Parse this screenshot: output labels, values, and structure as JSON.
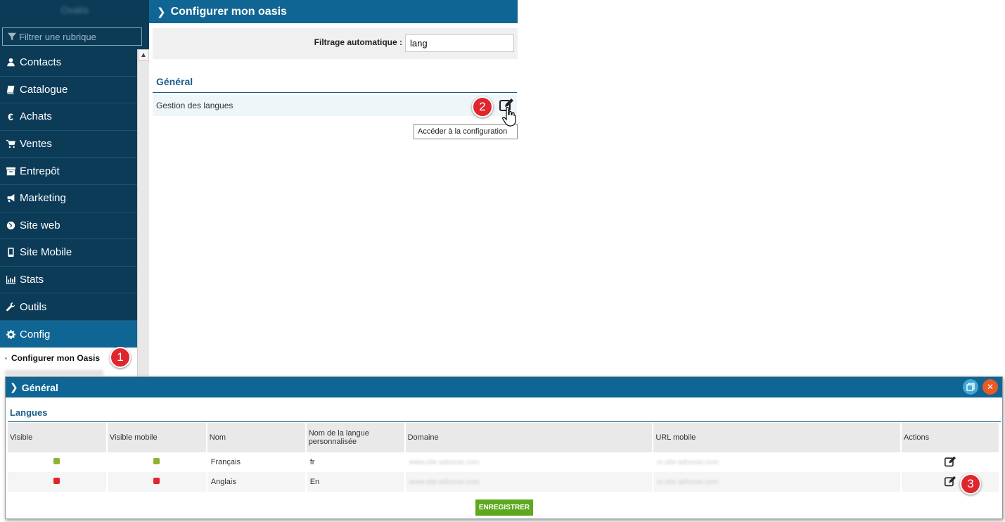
{
  "sidebar": {
    "brand": "Oxatis",
    "filter_placeholder": "Filtrer une rubrique",
    "items": [
      {
        "label": "Contacts",
        "icon": "user-icon"
      },
      {
        "label": "Catalogue",
        "icon": "book-icon"
      },
      {
        "label": "Achats",
        "icon": "euro-icon"
      },
      {
        "label": "Ventes",
        "icon": "cart-icon"
      },
      {
        "label": "Entrepôt",
        "icon": "archive-icon"
      },
      {
        "label": "Marketing",
        "icon": "megaphone-icon"
      },
      {
        "label": "Site web",
        "icon": "globe-icon"
      },
      {
        "label": "Site Mobile",
        "icon": "mobile-icon"
      },
      {
        "label": "Stats",
        "icon": "bar-chart-icon"
      },
      {
        "label": "Outils",
        "icon": "wrench-icon"
      },
      {
        "label": "Config",
        "icon": "gear-icon"
      }
    ],
    "current_sub": "Configurer mon Oasis"
  },
  "badges": {
    "one": "1",
    "two": "2",
    "three": "3"
  },
  "main": {
    "title": "Configurer mon oasis",
    "filter_label": "Filtrage automatique :",
    "filter_value": "lang",
    "section": "Général",
    "row_label": "Gestion des langues",
    "tooltip": "Accéder à la configuration"
  },
  "modal": {
    "title": "Général",
    "section": "Langues",
    "columns": [
      "Visible",
      "Visible mobile",
      "Nom",
      "Nom de la langue personnalisée",
      "Domaine",
      "URL mobile",
      "Actions"
    ],
    "rows": [
      {
        "visible_color": "#8ab531",
        "mobile_color": "#8ab531",
        "nom": "Français",
        "perso": "fr",
        "domaine": "www.site-adresse.com",
        "url_mobile": "m.site-adresse.com"
      },
      {
        "visible_color": "#e0262d",
        "mobile_color": "#e0262d",
        "nom": "Anglais",
        "perso": "En",
        "domaine": "www.site-adresse.com",
        "url_mobile": "m.site-adresse.com"
      }
    ],
    "save_label": "ENREGISTRER"
  },
  "colors": {
    "sidebar": "#0b3b57",
    "accent": "#0f6694",
    "save": "#5ea820"
  }
}
